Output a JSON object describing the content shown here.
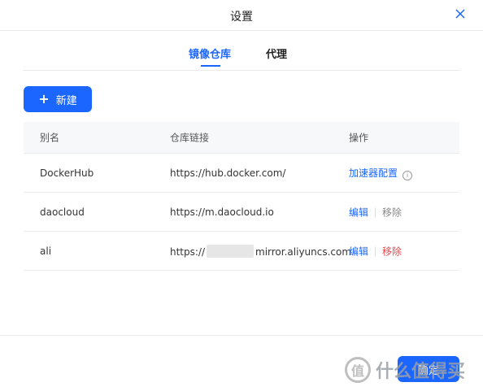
{
  "dialog": {
    "title": "设置",
    "close_icon": "close-icon"
  },
  "tabs": [
    {
      "label": "镜像仓库",
      "active": true
    },
    {
      "label": "代理",
      "active": false
    }
  ],
  "toolbar": {
    "new_label": "新建",
    "new_icon": "plus-icon"
  },
  "table": {
    "headers": [
      "别名",
      "仓库链接",
      "操作"
    ],
    "rows": [
      {
        "alias": "DockerHub",
        "url": "https://hub.docker.com/",
        "actions": [
          {
            "label": "加速器配置",
            "style": "link"
          }
        ],
        "info_icon": "info-icon"
      },
      {
        "alias": "daocloud",
        "url": "https://m.daocloud.io",
        "actions": [
          {
            "label": "编辑",
            "style": "link"
          },
          {
            "label": "移除",
            "style": "muted"
          }
        ]
      },
      {
        "alias": "ali",
        "url_prefix": "https://",
        "url_suffix": "mirror.aliyuncs.com",
        "actions": [
          {
            "label": "编辑",
            "style": "link"
          },
          {
            "label": "移除",
            "style": "danger"
          }
        ]
      }
    ]
  },
  "footer": {
    "confirm_label": "确定"
  },
  "watermark": {
    "logo_text": "值",
    "text": "什么值得买"
  },
  "colors": {
    "accent": "#1a66ff",
    "danger": "#e5484d",
    "muted": "#888888"
  }
}
